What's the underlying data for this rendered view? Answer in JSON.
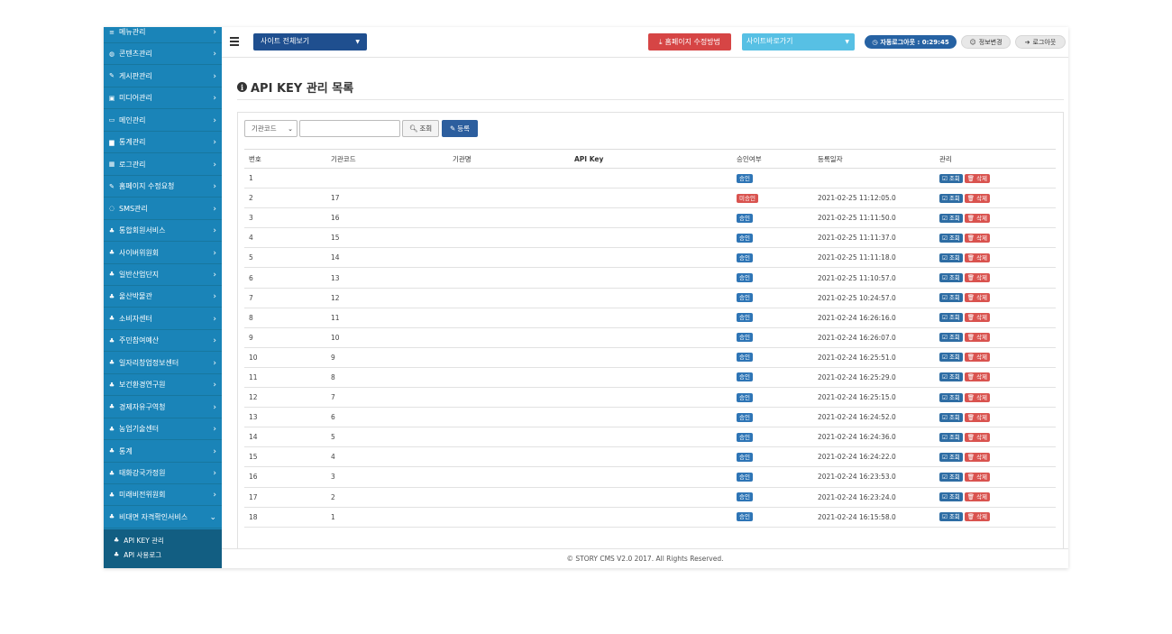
{
  "sidebar": {
    "items": [
      {
        "label": "메뉴관리",
        "icon": "list-icon"
      },
      {
        "label": "콘텐츠관리",
        "icon": "globe-icon"
      },
      {
        "label": "게시판관리",
        "icon": "edit-icon"
      },
      {
        "label": "미디어관리",
        "icon": "image-icon"
      },
      {
        "label": "메인관리",
        "icon": "monitor-icon"
      },
      {
        "label": "통계관리",
        "icon": "chart-icon"
      },
      {
        "label": "로그관리",
        "icon": "grid-icon"
      },
      {
        "label": "홈페이지 수정요청",
        "icon": "edit-icon"
      },
      {
        "label": "SMS관리",
        "icon": "chat-icon"
      },
      {
        "label": "통합회원서비스",
        "icon": "sitemap-icon"
      },
      {
        "label": "사이버위원회",
        "icon": "sitemap-icon"
      },
      {
        "label": "일반산업단지",
        "icon": "sitemap-icon"
      },
      {
        "label": "울산박물관",
        "icon": "sitemap-icon"
      },
      {
        "label": "소비자센터",
        "icon": "sitemap-icon"
      },
      {
        "label": "주민참여예산",
        "icon": "sitemap-icon"
      },
      {
        "label": "일자리창업정보센터",
        "icon": "sitemap-icon"
      },
      {
        "label": "보건환경연구원",
        "icon": "sitemap-icon"
      },
      {
        "label": "경제자유구역청",
        "icon": "sitemap-icon"
      },
      {
        "label": "농업기술센터",
        "icon": "sitemap-icon"
      },
      {
        "label": "통계",
        "icon": "sitemap-icon"
      },
      {
        "label": "태화강국가정원",
        "icon": "sitemap-icon"
      },
      {
        "label": "미래비전위원회",
        "icon": "sitemap-icon"
      },
      {
        "label": "비대면 자격확인서비스",
        "icon": "sitemap-icon"
      }
    ],
    "submenu": [
      {
        "label": "API KEY 관리"
      },
      {
        "label": "API 사용로그"
      }
    ]
  },
  "topbar": {
    "site_select": "사이트 전체보기",
    "edit_guide": "홈페이지 수정방법",
    "site_go": "사이트바로가기",
    "timer": "자동로그아웃 : 0:29:45",
    "profile": "정보변경",
    "logout": "로그아웃"
  },
  "page": {
    "title": "API KEY 관리 목록"
  },
  "search": {
    "select_value": "기관코드",
    "input_value": "",
    "search_label": "조회",
    "register_label": "등록"
  },
  "table": {
    "headers": [
      "번호",
      "기관코드",
      "기관명",
      "API Key",
      "승인여부",
      "등록일자",
      "관리"
    ],
    "view_label": "조회",
    "delete_label": "삭제",
    "rows": [
      {
        "no": "1",
        "code": "",
        "name": "",
        "key": "",
        "status": "승인",
        "date": ""
      },
      {
        "no": "2",
        "code": "17",
        "name": "",
        "key": "",
        "status": "미승인",
        "date": "2021-02-25 11:12:05.0"
      },
      {
        "no": "3",
        "code": "16",
        "name": "",
        "key": "",
        "status": "승인",
        "date": "2021-02-25 11:11:50.0"
      },
      {
        "no": "4",
        "code": "15",
        "name": "",
        "key": "",
        "status": "승인",
        "date": "2021-02-25 11:11:37.0"
      },
      {
        "no": "5",
        "code": "14",
        "name": "",
        "key": "",
        "status": "승인",
        "date": "2021-02-25 11:11:18.0"
      },
      {
        "no": "6",
        "code": "13",
        "name": "",
        "key": "",
        "status": "승인",
        "date": "2021-02-25 11:10:57.0"
      },
      {
        "no": "7",
        "code": "12",
        "name": "",
        "key": "",
        "status": "승인",
        "date": "2021-02-25 10:24:57.0"
      },
      {
        "no": "8",
        "code": "11",
        "name": "",
        "key": "",
        "status": "승인",
        "date": "2021-02-24 16:26:16.0"
      },
      {
        "no": "9",
        "code": "10",
        "name": "",
        "key": "",
        "status": "승인",
        "date": "2021-02-24 16:26:07.0"
      },
      {
        "no": "10",
        "code": "9",
        "name": "",
        "key": "",
        "status": "승인",
        "date": "2021-02-24 16:25:51.0"
      },
      {
        "no": "11",
        "code": "8",
        "name": "",
        "key": "",
        "status": "승인",
        "date": "2021-02-24 16:25:29.0"
      },
      {
        "no": "12",
        "code": "7",
        "name": "",
        "key": "",
        "status": "승인",
        "date": "2021-02-24 16:25:15.0"
      },
      {
        "no": "13",
        "code": "6",
        "name": "",
        "key": "",
        "status": "승인",
        "date": "2021-02-24 16:24:52.0"
      },
      {
        "no": "14",
        "code": "5",
        "name": "",
        "key": "",
        "status": "승인",
        "date": "2021-02-24 16:24:36.0"
      },
      {
        "no": "15",
        "code": "4",
        "name": "",
        "key": "",
        "status": "승인",
        "date": "2021-02-24 16:24:22.0"
      },
      {
        "no": "16",
        "code": "3",
        "name": "",
        "key": "",
        "status": "승인",
        "date": "2021-02-24 16:23:53.0"
      },
      {
        "no": "17",
        "code": "2",
        "name": "",
        "key": "",
        "status": "승인",
        "date": "2021-02-24 16:23:24.0"
      },
      {
        "no": "18",
        "code": "1",
        "name": "",
        "key": "",
        "status": "승인",
        "date": "2021-02-24 16:15:58.0"
      }
    ]
  },
  "footer": {
    "text": "© STORY CMS V2.0 2017. All Rights Reserved."
  },
  "colors": {
    "sidebar": "#1a84b8",
    "sidebar_sub": "#125e82",
    "primary": "#1f4f8f",
    "danger": "#d64545",
    "info": "#57c0e4",
    "badge_ok": "#2e75b6",
    "badge_no": "#d9534f"
  }
}
